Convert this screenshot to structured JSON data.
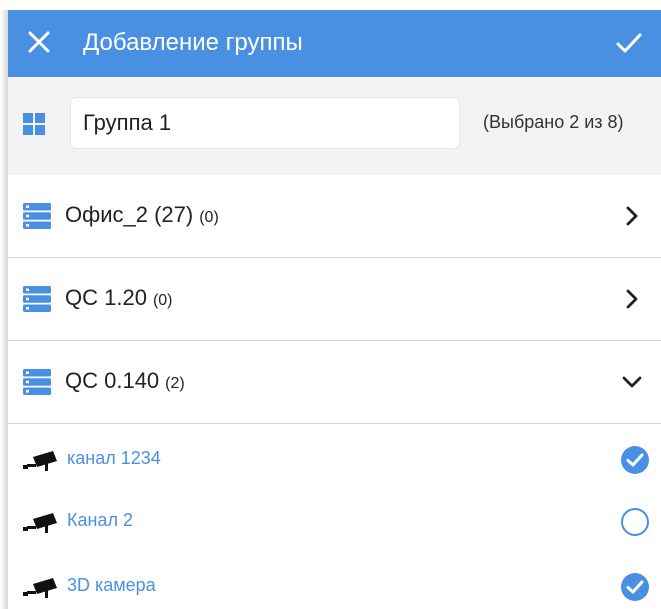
{
  "header": {
    "title": "Добавление группы",
    "close_icon": "close-icon",
    "confirm_icon": "check-icon",
    "background_color": "#4a90e2"
  },
  "group": {
    "icon": "grid-icon",
    "name_value": "Группа 1",
    "selection_status": "(Выбрано 2 из 8)"
  },
  "servers": [
    {
      "name": "Офис_2 (27)",
      "count": "(0)",
      "icon": "server-icon",
      "state": "collapsed"
    },
    {
      "name": "QC 1.20",
      "count": "(0)",
      "icon": "server-icon",
      "state": "collapsed"
    },
    {
      "name": "QC 0.140",
      "count": "(2)",
      "icon": "server-icon",
      "state": "expanded"
    }
  ],
  "channels": [
    {
      "name": "канал 1234",
      "checked": true,
      "icon": "camera-icon"
    },
    {
      "name": "Канал 2",
      "checked": false,
      "icon": "camera-icon"
    },
    {
      "name": "3D камера",
      "checked": true,
      "icon": "camera-icon"
    }
  ],
  "colors": {
    "accent": "#4a90e2",
    "divider": "#d6d6d6",
    "group_bar_bg": "#f3f3f3"
  }
}
